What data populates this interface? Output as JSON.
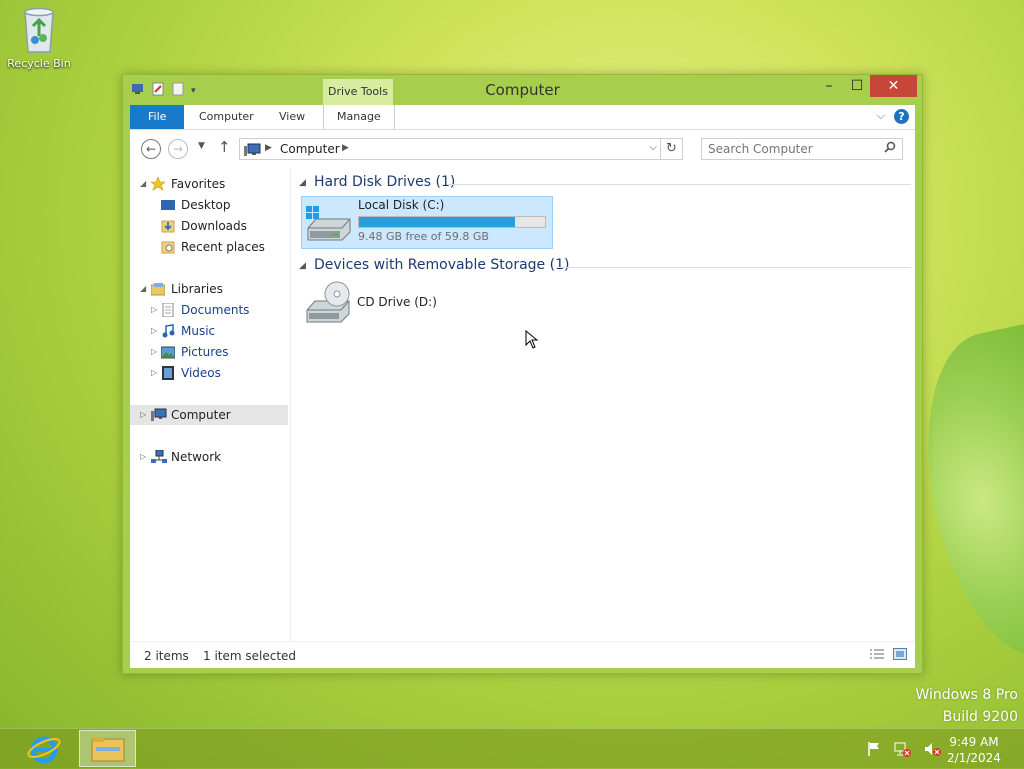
{
  "desktop": {
    "recycle_bin_label": "Recycle Bin",
    "watermark_line1": "Windows 8 Pro",
    "watermark_line2": "Build 9200"
  },
  "window": {
    "title": "Computer",
    "context_tab": "Drive Tools",
    "controls": {
      "minimize": "–",
      "maximize": "☐",
      "close": "✕"
    }
  },
  "ribbon": {
    "tabs": [
      "File",
      "Computer",
      "View",
      "Manage"
    ],
    "collapse": "⌵",
    "help": "?"
  },
  "address_bar": {
    "location": "Computer",
    "search_placeholder": "Search Computer"
  },
  "navigation": {
    "favorites": {
      "label": "Favorites",
      "items": [
        "Desktop",
        "Downloads",
        "Recent places"
      ]
    },
    "libraries": {
      "label": "Libraries",
      "items": [
        "Documents",
        "Music",
        "Pictures",
        "Videos"
      ]
    },
    "computer": "Computer",
    "network": "Network"
  },
  "main": {
    "groups": [
      {
        "title": "Hard Disk Drives (1)"
      },
      {
        "title": "Devices with Removable Storage (1)"
      }
    ],
    "drives": [
      {
        "name": "Local Disk (C:)",
        "free_text": "9.48 GB free of 59.8 GB",
        "used_fraction": 0.84
      },
      {
        "name": "CD Drive (D:)"
      }
    ]
  },
  "status": {
    "items": "2 items",
    "selected": "1 item selected"
  },
  "taskbar": {
    "time": "9:49 AM",
    "date": "2/1/2024"
  },
  "colors": {
    "accent": "#1979ca",
    "selection": "#cce8ff",
    "close_button": "#c7463a",
    "drive_bar": "#26a0da"
  },
  "icons": [
    "recycle-bin-icon",
    "ie-icon",
    "explorer-icon",
    "flag-icon",
    "network-icon",
    "volume-muted-icon"
  ]
}
